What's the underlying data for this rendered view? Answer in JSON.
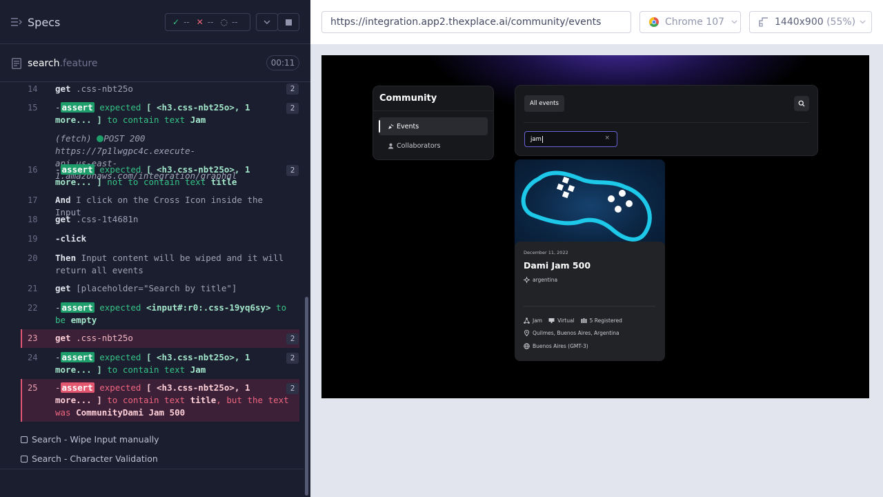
{
  "reporter": {
    "title": "Specs",
    "stats": {
      "passed": "--",
      "failed": "--",
      "pending": "--"
    },
    "file": {
      "name": "search",
      "ext": ".feature",
      "time": "00:11"
    },
    "commands": [
      {
        "num": "14",
        "badge": "2"
      },
      {
        "num": "15",
        "badge": "2"
      },
      {
        "num": "",
        "badge": ""
      },
      {
        "num": "16",
        "badge": "2"
      },
      {
        "num": "17",
        "badge": ""
      },
      {
        "num": "18",
        "badge": ""
      },
      {
        "num": "19",
        "badge": ""
      },
      {
        "num": "20",
        "badge": ""
      },
      {
        "num": "21",
        "badge": ""
      },
      {
        "num": "22",
        "badge": ""
      },
      {
        "num": "23",
        "badge": "2"
      },
      {
        "num": "24",
        "badge": "2"
      },
      {
        "num": "25",
        "badge": "2"
      }
    ],
    "text": {
      "c14": {
        "kw": "get",
        "sel": ".css-nbt25o"
      },
      "c15": {
        "assert": "assert",
        "expected": "expected",
        "a": "[ <h3.css-nbt25o>, 1",
        "b": "more... ]",
        "mid": "to contain text",
        "val": "Jam"
      },
      "fetch": {
        "label": "(fetch)",
        "l1": "POST 200 https://7p1lwgpc4c.execute-",
        "l2": "api.us-east-1.amazonaws.com/integration/graphql"
      },
      "c16": {
        "assert": "assert",
        "expected": "expected",
        "a": "[ <h3.css-nbt25o>, 1",
        "b": "more... ]",
        "mid": "not to contain text",
        "val": "title"
      },
      "c17": {
        "kw": "And",
        "rest": "I click on the Cross Icon inside the Input"
      },
      "c18": {
        "kw": "get",
        "sel": ".css-1t4681n"
      },
      "c19": {
        "kw": "-click"
      },
      "c20": {
        "kw": "Then",
        "l1": "Input content will be wiped and it will",
        "l2": "return all events"
      },
      "c21": {
        "kw": "get",
        "sel": "[placeholder=\"Search by title\"]"
      },
      "c22": {
        "assert": "assert",
        "expected": "expected",
        "a": "<input#:r0:.css-19yq6sy>",
        "b1": "to",
        "b2": "be",
        "val": "empty"
      },
      "c23": {
        "kw": "get",
        "sel": ".css-nbt25o"
      },
      "c24": {
        "assert": "assert",
        "expected": "expected",
        "a": "[ <h3.css-nbt25o>, 1",
        "b": "more... ]",
        "mid": "to contain text",
        "val": "Jam"
      },
      "c25": {
        "assert": "assert",
        "expected": "expected",
        "a": "[ <h3.css-nbt25o>, 1",
        "b": "more... ]",
        "mid": "to contain text",
        "val": "title",
        "tail": ", but the text",
        "was": "was",
        "val2": "CommunityDami Jam 500"
      }
    },
    "tests": [
      "Search - Wipe Input manually",
      "Search - Character Validation"
    ]
  },
  "aut": {
    "url": "https://integration.app2.thexplace.ai/community/events",
    "browser": "Chrome 107",
    "viewport": "1440x900",
    "zoom": "(55%)"
  },
  "app": {
    "sidebar": {
      "title": "Community",
      "items": [
        "Events",
        "Collaborators"
      ]
    },
    "tab": "All events",
    "search_value": "jam",
    "card": {
      "date": "December 11, 2022",
      "title": "Dami Jam 500",
      "location": "argentina",
      "type": "Jam",
      "mode": "Virtual",
      "registered": "5 Registered",
      "address": "Quilmes, Buenos Aires, Argentina",
      "timezone": "Buenos Aires (GMT-3)"
    }
  },
  "colors": {
    "pass": "#35c486",
    "fail": "#e45770",
    "accent": "#6b62d8",
    "controller": "#1ec8e8"
  }
}
